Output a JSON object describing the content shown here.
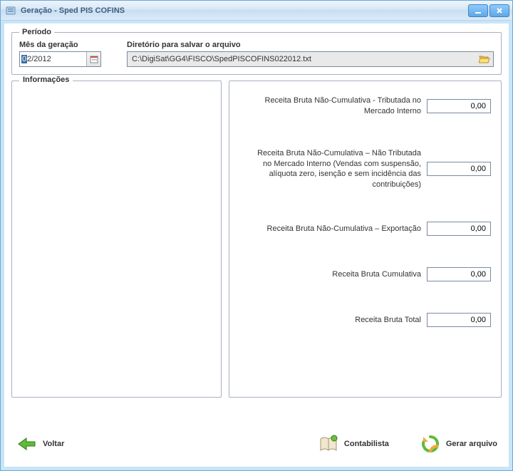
{
  "window": {
    "title": "Geração - Sped PIS COFINS"
  },
  "periodo": {
    "legend": "Período",
    "mes_label": "Mês da geração",
    "mes_value_prefix_selected": "0",
    "mes_value_rest": "2/2012",
    "dir_label": "Diretório para salvar o arquivo",
    "dir_value": "C:\\DigiSat\\GG4\\FISCO\\SpedPISCOFINS022012.txt"
  },
  "informacoes": {
    "legend": "Informações"
  },
  "fields": [
    {
      "label": "Receita Bruta Não-Cumulativa - Tributada no Mercado Interno",
      "value": "0,00"
    },
    {
      "label": "Receita Bruta Não-Cumulativa – Não Tributada no Mercado Interno (Vendas com suspensão, alíquota zero, isenção e sem incidência das contribuições)",
      "value": "0,00"
    },
    {
      "label": "Receita Bruta Não-Cumulativa – Exportação",
      "value": "0,00"
    },
    {
      "label": "Receita Bruta Cumulativa",
      "value": "0,00"
    },
    {
      "label": "Receita Bruta Total",
      "value": "0,00"
    }
  ],
  "footer": {
    "voltar": "Voltar",
    "contabilista": "Contabilista",
    "gerar": "Gerar arquivo"
  }
}
